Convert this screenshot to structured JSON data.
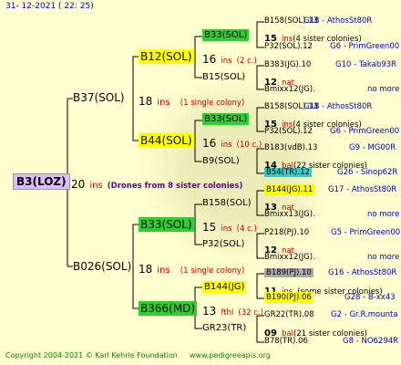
{
  "header": {
    "date": "31- 12-2021 ( 22: 25)"
  },
  "footer": {
    "copyright": "Copyright 2004-2021 © Karl Kehrle Foundation",
    "site": "www.pedigreeapis.org"
  },
  "root": {
    "name": "B3(LOZ)",
    "num": "20",
    "ins": "ins",
    "note": "(Drones from 8 sister colonies)"
  },
  "gen1": [
    {
      "name": "B37(SOL)",
      "num": "18",
      "ins": "ins",
      "note": "(1 single colony)"
    },
    {
      "name": "B026(SOL)",
      "num": "18",
      "ins": "ins",
      "note": "(1 single colony)"
    }
  ],
  "gen2": [
    {
      "name": "B12(SOL)",
      "num": "16",
      "ins": "ins",
      "note": "(2 c.)",
      "dam": "B33(SOL)",
      "sire": "B15(SOL)"
    },
    {
      "name": "B44(SOL)",
      "num": "16",
      "ins": "ins",
      "note": "(10 c.)",
      "dam": "B33(SOL)",
      "sire": "B9(SOL)"
    },
    {
      "name": "B33(SOL)",
      "num": "15",
      "ins": "ins",
      "note": "(4 c.)",
      "dam": "B158(SOL)",
      "sire": "P32(SOL)"
    },
    {
      "name": "B366(MD)",
      "num": "13",
      "ins": "fthl",
      "note": "(32 c.)",
      "dam": "B144(JG)",
      "sire": "GR23(TR)"
    }
  ],
  "gen4": [
    {
      "l1": "B158(SOL).13",
      "l1r": "G18 - AthosSt80R",
      "num": "15",
      "ins": "ins",
      "note": "(4 sister colonies)",
      "l3": "P32(SOL).12",
      "l3r": "G6 - PrimGreen00"
    },
    {
      "l1": "B383(JG).10",
      "l1r": "G10 - Takab93R",
      "num": "12",
      "ins": "nat",
      "note": "",
      "l3": "Bmixx12(JG).",
      "l3r": "no more"
    },
    {
      "l1": "B158(SOL).13",
      "l1r": "G18 - AthosSt80R",
      "num": "15",
      "ins": "ins",
      "note": "(4 sister colonies)",
      "l3": "P32(SOL).12",
      "l3r": "G6 - PrimGreen00"
    },
    {
      "l1": "B183(vdB).13",
      "l1r": "G9 - MG00R",
      "num": "14",
      "ins": "bal",
      "note": "(22 sister colonies)",
      "l3": "B54(TR).12",
      "l3r": "G26 - Sinop62R"
    },
    {
      "l1": "B144(JG).11",
      "l1r": "G17 - AthosSt80R",
      "num": "13",
      "ins": "nat",
      "note": "",
      "l3": "Bmixx13(JG).",
      "l3r": "no more"
    },
    {
      "l1": "P218(PJ).10",
      "l1r": "G5 - PrimGreen00",
      "num": "12",
      "ins": "nat",
      "note": "",
      "l3": "Bmixx12(JG).",
      "l3r": "no more"
    },
    {
      "l1": "B189(PJ).10",
      "l1r": "G16 - AthosSt80R",
      "num": "11",
      "ins": "ins",
      "note": "(some sister colonies)",
      "l3": "B190(PJ).06",
      "l3r": "G28 - B-xx43"
    },
    {
      "l1": "GR22(TR).08",
      "l1r": "G2 - Gr.R.mounta",
      "num": "09",
      "ins": "bal",
      "note": "(21 sister colonies)",
      "l3": "B78(TR).06",
      "l3r": "G8 - NO6294R"
    }
  ]
}
